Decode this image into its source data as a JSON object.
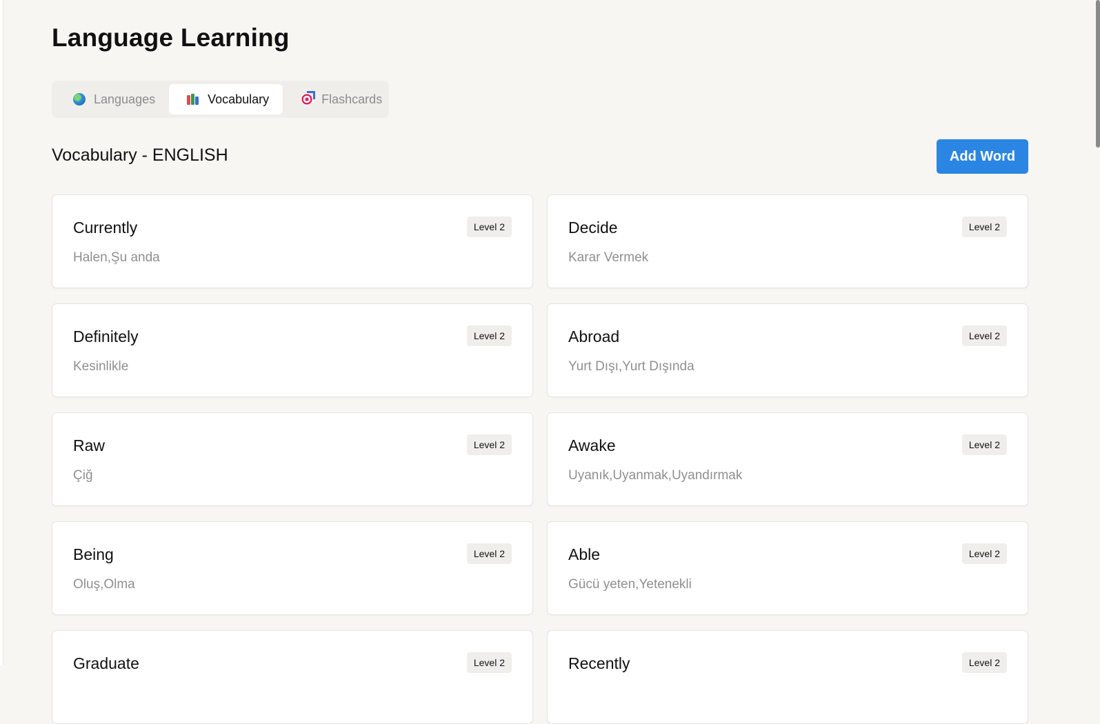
{
  "app": {
    "title": "Language Learning"
  },
  "tabs": [
    {
      "label": "Languages",
      "icon": "globe-icon",
      "active": false
    },
    {
      "label": "Vocabulary",
      "icon": "books-icon",
      "active": true
    },
    {
      "label": "Flashcards",
      "icon": "target-icon",
      "active": false
    }
  ],
  "section": {
    "title": "Vocabulary - ENGLISH",
    "add_label": "Add Word"
  },
  "words": [
    {
      "word": "Currently",
      "translation": "Halen,Şu anda",
      "level": "Level 2"
    },
    {
      "word": "Decide",
      "translation": "Karar Vermek",
      "level": "Level 2"
    },
    {
      "word": "Definitely",
      "translation": "Kesinlikle",
      "level": "Level 2"
    },
    {
      "word": "Abroad",
      "translation": "Yurt Dışı,Yurt Dışında",
      "level": "Level 2"
    },
    {
      "word": "Raw",
      "translation": "Çiğ",
      "level": "Level 2"
    },
    {
      "word": "Awake",
      "translation": "Uyanık,Uyanmak,Uyandırmak",
      "level": "Level 2"
    },
    {
      "word": "Being",
      "translation": "Oluş,Olma",
      "level": "Level 2"
    },
    {
      "word": "Able",
      "translation": "Gücü yeten,Yetenekli",
      "level": "Level 2"
    },
    {
      "word": "Graduate",
      "translation": "",
      "level": "Level 2"
    },
    {
      "word": "Recently",
      "translation": "",
      "level": "Level 2"
    }
  ],
  "colors": {
    "accent": "#2b86e3",
    "background": "#f7f6f3"
  }
}
